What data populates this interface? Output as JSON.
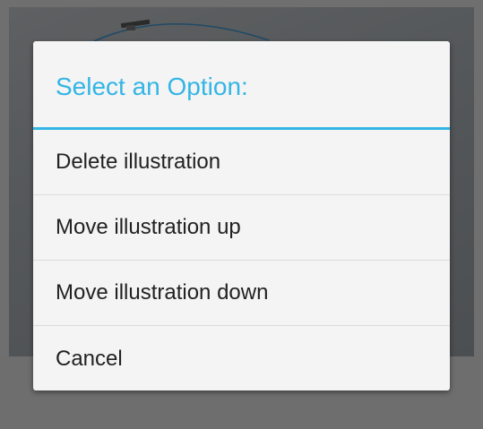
{
  "dialog": {
    "title": "Select an Option:",
    "options": [
      {
        "label": "Delete illustration"
      },
      {
        "label": "Move illustration up"
      },
      {
        "label": "Move illustration down"
      },
      {
        "label": "Cancel"
      }
    ]
  },
  "colors": {
    "accent": "#33b5e5",
    "dialog_background": "#f4f4f4",
    "scrim": "#6f6f6f"
  }
}
